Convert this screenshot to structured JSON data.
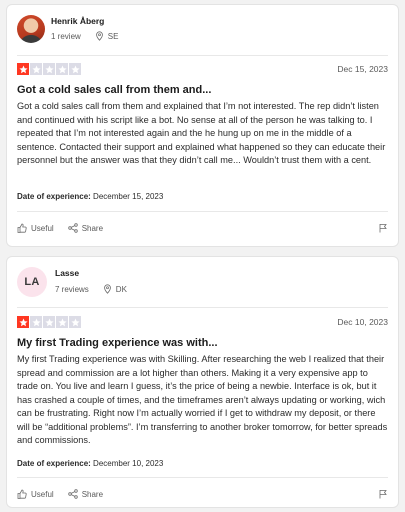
{
  "colors": {
    "star_on": "#ff3722",
    "star_off": "#dcdce6",
    "avatar_initials_bg": "#fbe3ec"
  },
  "reviews": [
    {
      "avatar": {
        "type": "photo",
        "initials": ""
      },
      "name": "Henrik Åberg",
      "review_count": "1 review",
      "country": "SE",
      "rating": 1,
      "date": "Dec 15, 2023",
      "title": "Got a cold sales call from them and...",
      "body": "Got a cold sales call from them and explained that I’m not interested. The rep didn’t listen and continued with his script like a bot. No sense at all of the person he was talking to. I repeated that I’m not interested again and the he hung up on me in the middle of a sentence. Contacted their support and explained what happened so they can educate their personnel but the answer was that they didn’t call me... Wouldn’t trust them with a cent.",
      "experience_label": "Date of experience:",
      "experience_date": "December 15, 2023",
      "useful_label": "Useful",
      "share_label": "Share"
    },
    {
      "avatar": {
        "type": "initials",
        "initials": "LA"
      },
      "name": "Lasse",
      "review_count": "7 reviews",
      "country": "DK",
      "rating": 1,
      "date": "Dec 10, 2023",
      "title": "My first Trading experience was with...",
      "body": "My first Trading experience was with Skilling. After researching the web I realized that their spread and commission are a lot higher than others. Making it a very expensive app to trade on. You live and learn I guess, it’s the price of being a newbie. Interface is ok, but it has crashed a couple of times, and the timeframes aren’t always updating or working, wich can be frustrating. Right now I’m actually worried if I get to withdraw my deposit, or there will be “additional problems”. I’m transferring to another broker tomorrow, for better spreads and commissions.",
      "experience_label": "Date of experience:",
      "experience_date": "December 10, 2023",
      "useful_label": "Useful",
      "share_label": "Share"
    }
  ]
}
